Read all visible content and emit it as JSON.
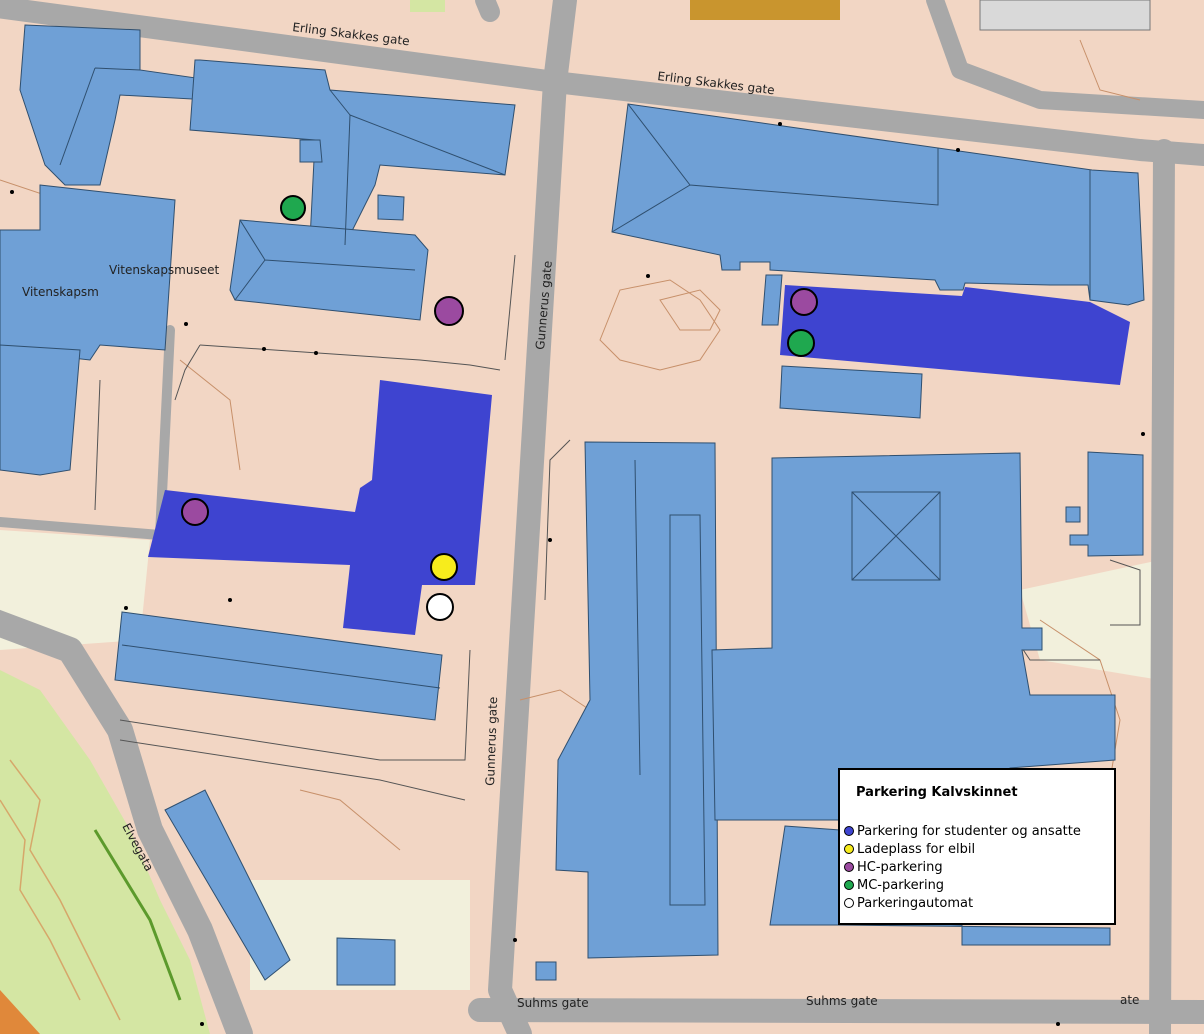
{
  "streets": {
    "erling_1": "Erling Skakkes gate",
    "erling_2": "Erling Skakkes gate",
    "gunnerus_1": "Gunnerus gate",
    "gunnerus_2": "Gunnerus gate",
    "suhms_1": "Suhms gate",
    "suhms_2": "Suhms gate",
    "suhms_3": "ate",
    "elvegata": "Elvegata"
  },
  "places": {
    "vitenskapsmuseet": "Vitenskapsmuseet",
    "vitenskapsm": "Vitenskapsm"
  },
  "legend": {
    "title": "Parkering Kalvskinnet",
    "items": [
      {
        "label": "Parkering for studenter og ansatte",
        "color": "#3e44d0"
      },
      {
        "label": "Ladeplass for elbil",
        "color": "#f7ec1c"
      },
      {
        "label": "HC-parkering",
        "color": "#9b4aa0"
      },
      {
        "label": "MC-parkering",
        "color": "#1fa84f"
      },
      {
        "label": "Parkeringautomat",
        "color": "#ffffff"
      }
    ]
  },
  "colors": {
    "land": "#f2d6c4",
    "road": "#a8a8a8",
    "building": "#6fa0d6",
    "parking": "#3e44d0",
    "park": "#d4e6a3",
    "path": "#f2f0dc"
  }
}
